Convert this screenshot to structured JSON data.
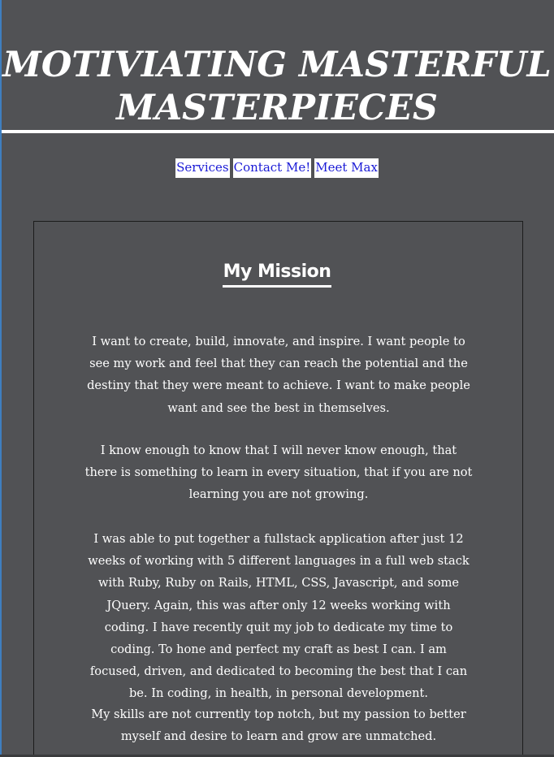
{
  "header": {
    "title_line1": "MOTIVIATING MASTERFUL",
    "title_line2": "MASTERPIECES"
  },
  "nav": {
    "items": [
      {
        "label": "Services"
      },
      {
        "label": "Contact Me!"
      },
      {
        "label": "Meet Max"
      }
    ]
  },
  "mission": {
    "heading": "My Mission",
    "paragraphs": [
      "I want to create, build, innovate, and inspire. I want people to see my work and feel that they can reach the potential and the destiny that they were meant to achieve. I want to make people want and see the best in themselves.",
      "I know enough to know that I will never know enough, that there is something to learn in every situation, that if you are not learning you are not growing.",
      "I was able to put together a fullstack application after just 12 weeks of working with 5 different languages in a full web stack with Ruby, Ruby on Rails, HTML, CSS, Javascript, and some JQuery. Again, this was after only 12 weeks working with coding. I have recently quit my job to dedicate my time to coding. To hone and perfect my craft as best I can. I am focused, driven, and dedicated to becoming the best that I can be. In coding, in health, in personal development.",
      "My skills are not currently top notch, but my passion to better myself and desire to learn and grow are unmatched."
    ]
  },
  "colors": {
    "background": "#515255",
    "text": "#ffffff",
    "link": "#1a1ad6",
    "nav_background": "#ffffff",
    "card_border": "#1c1c1c",
    "edge_accent": "#3f7fc0"
  }
}
